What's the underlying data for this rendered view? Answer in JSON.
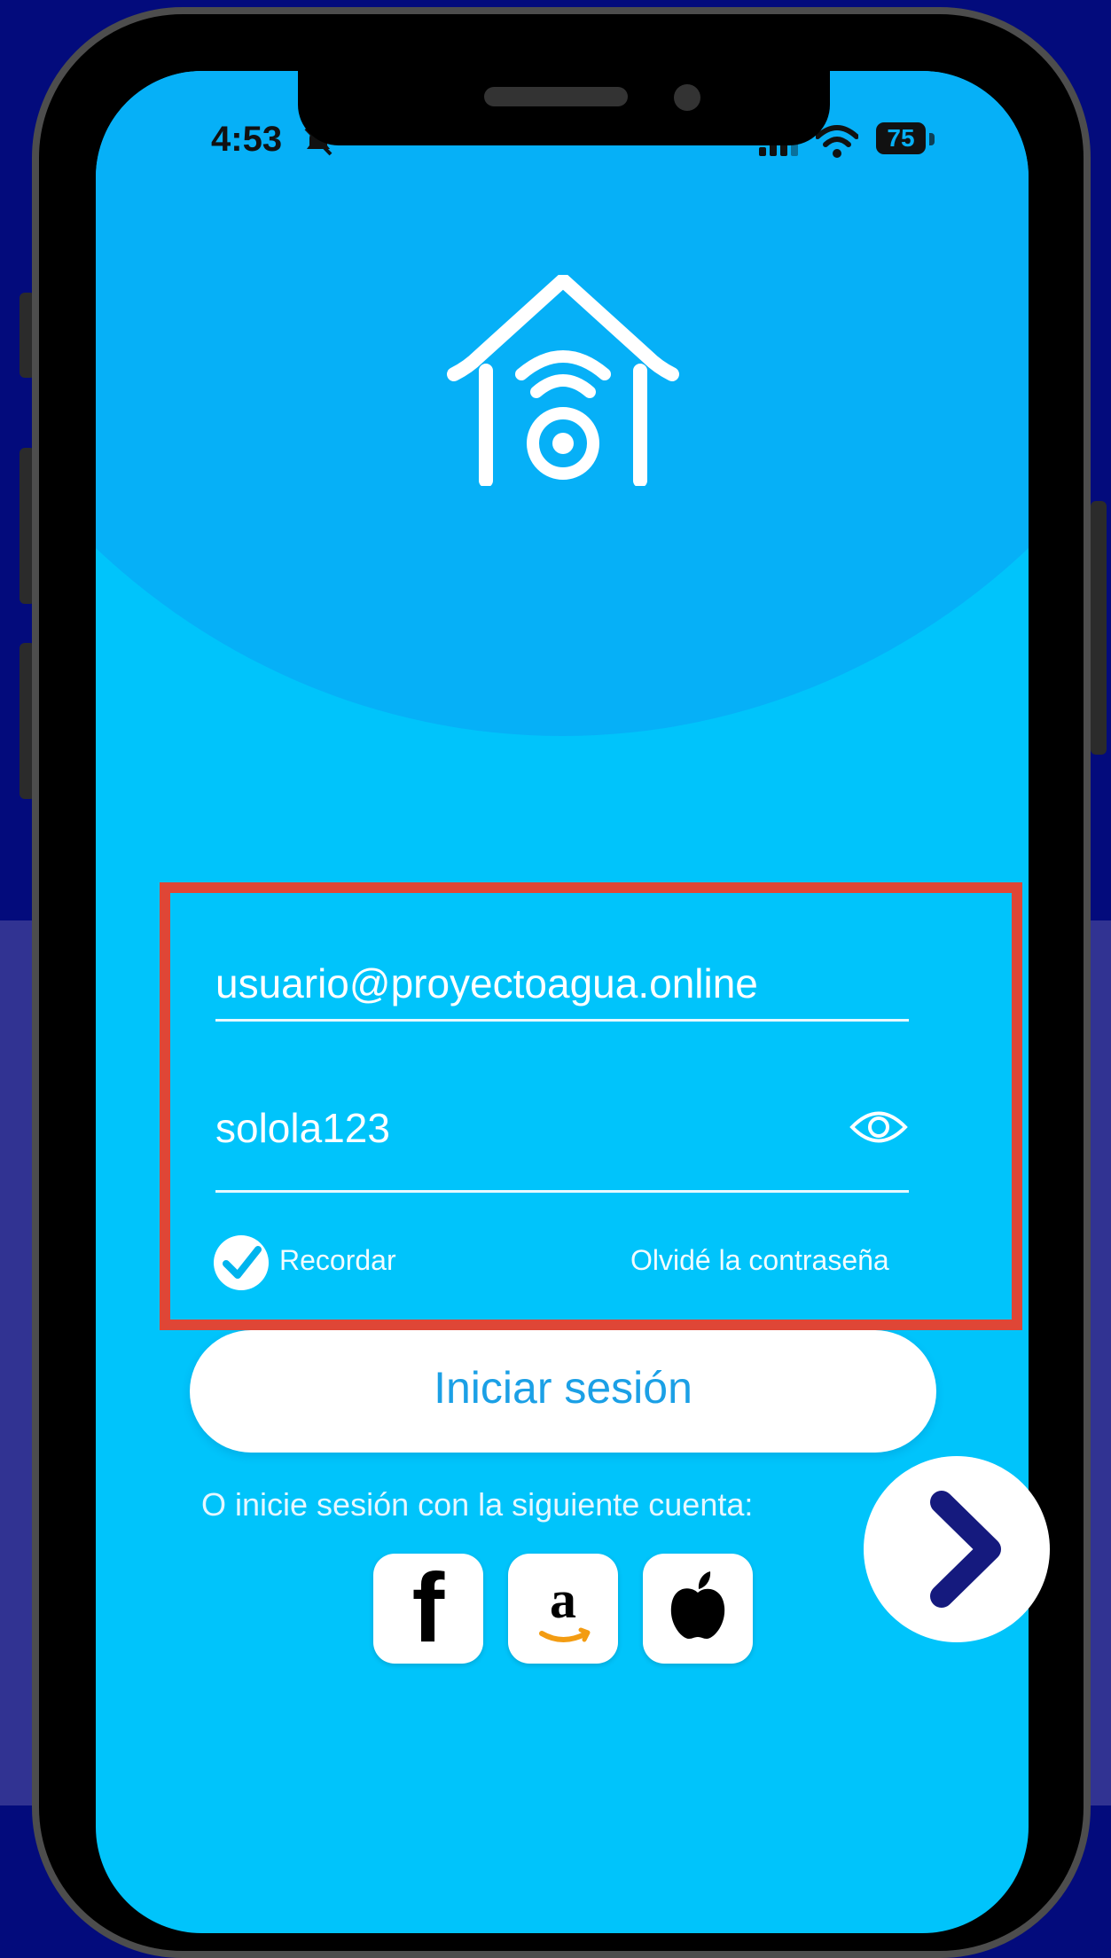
{
  "status_bar": {
    "time": "4:53",
    "battery": "75"
  },
  "login_form": {
    "email_value": "usuario@proyectoagua.online",
    "password_value": "sololа123",
    "remember_label": "Recordar",
    "forgot_label": "Olvidé la contraseña",
    "submit_label": "Iniciar sesión",
    "alt_login_text": "O inicie sesión con la siguiente cuenta:"
  },
  "social_logins": [
    {
      "name": "facebook",
      "glyph": "f"
    },
    {
      "name": "amazon",
      "glyph": "a"
    },
    {
      "name": "apple",
      "glyph": "apple-icon"
    }
  ],
  "colors": {
    "background_top": "#030b7c",
    "background_bottom": "#313392",
    "screen": "#00c4fb",
    "header": "#06b0f7",
    "highlight_border": "#df4636",
    "button_text": "#1ba0e6",
    "next_chevron": "#151a7e"
  },
  "icons": [
    "logo-house-wifi-icon",
    "mute-bell-icon",
    "signal-icon",
    "wifi-icon",
    "battery-icon",
    "eye-icon",
    "check-icon",
    "facebook-icon",
    "amazon-icon",
    "apple-icon",
    "chevron-right-icon"
  ]
}
